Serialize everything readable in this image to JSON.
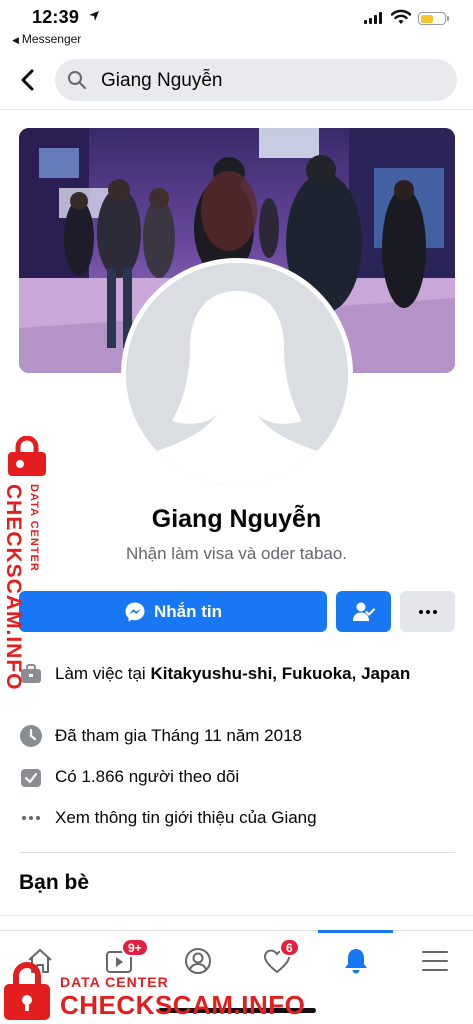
{
  "status_bar": {
    "time": "12:39",
    "back_app": "Messenger"
  },
  "header": {
    "search_value": "Giang Nguyễn"
  },
  "profile": {
    "name": "Giang Nguyễn",
    "bio": "Nhận làm visa và oder tabao."
  },
  "actions": {
    "message_label": "Nhắn tin"
  },
  "intro": {
    "work_prefix": "Làm việc tại ",
    "work_place": "Kitakyushu-shi, Fukuoka, Japan",
    "joined": "Đã tham gia Tháng 11 năm 2018",
    "followers": "Có 1.866 người theo dõi",
    "see_about": "Xem thông tin giới thiệu của Giang"
  },
  "sections": {
    "friends_title": "Bạn bè"
  },
  "tabbar": {
    "video_badge": "9+",
    "dating_badge": "6",
    "active_tab": "notifications"
  },
  "watermark": {
    "sub": "DATA CENTER",
    "main": "CHECKSCAM.INFO"
  },
  "colors": {
    "accent": "#1877f2",
    "badge": "#e41e3f",
    "watermark": "#e41e1e"
  }
}
